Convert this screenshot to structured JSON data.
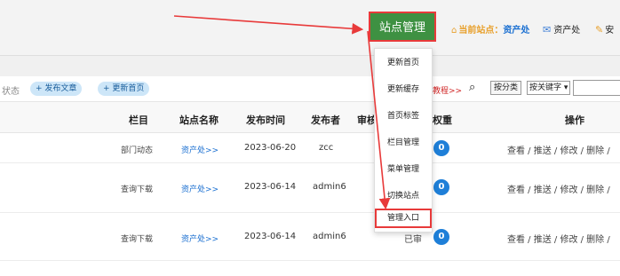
{
  "topbar": {
    "site_manage_label": "站点管理",
    "current_site_label": "当前站点：",
    "current_site_value": "资产处",
    "mail_label": "资产处",
    "safe_label": "安"
  },
  "toolbar": {
    "status_label": "状态",
    "publish_label": "+ 发布文章",
    "update_home_label": "+ 更新首页",
    "tutorial_label": "教程>>",
    "category_label": "按分类",
    "keyword_label": "按关键字 ▾"
  },
  "table": {
    "headers": {
      "column": "栏目",
      "site": "站点名称",
      "time": "发布时间",
      "publisher": "发布者",
      "review": "审核",
      "weight": "权重",
      "ops": "操作"
    },
    "rows": [
      {
        "column": "部门动态",
        "site": "资产处>>",
        "time": "2023-06-20",
        "publisher": "zcc",
        "status": "",
        "weight": "0",
        "ops": "查看 / 推送 / 修改 / 删除 /"
      },
      {
        "column": "查询下载",
        "site": "资产处>>",
        "time": "2023-06-14",
        "publisher": "admin6",
        "status": "",
        "weight": "0",
        "ops": "查看 / 推送 / 修改 / 删除 /"
      },
      {
        "column": "查询下载",
        "site": "资产处>>",
        "time": "2023-06-14",
        "publisher": "admin6",
        "status": "已审",
        "weight": "0",
        "ops": "查看 / 推送 / 修改 / 删除 /"
      }
    ]
  },
  "dropdown": {
    "items": [
      "更新首页",
      "更新缓存",
      "首页标签",
      "栏目管理",
      "菜单管理",
      "切换站点",
      "管理入口"
    ]
  },
  "colors": {
    "site_manage_bg": "#3e9142",
    "highlight_red": "#e83a3a",
    "link_blue": "#1a6fd1",
    "badge_blue": "#1e7fd8"
  }
}
